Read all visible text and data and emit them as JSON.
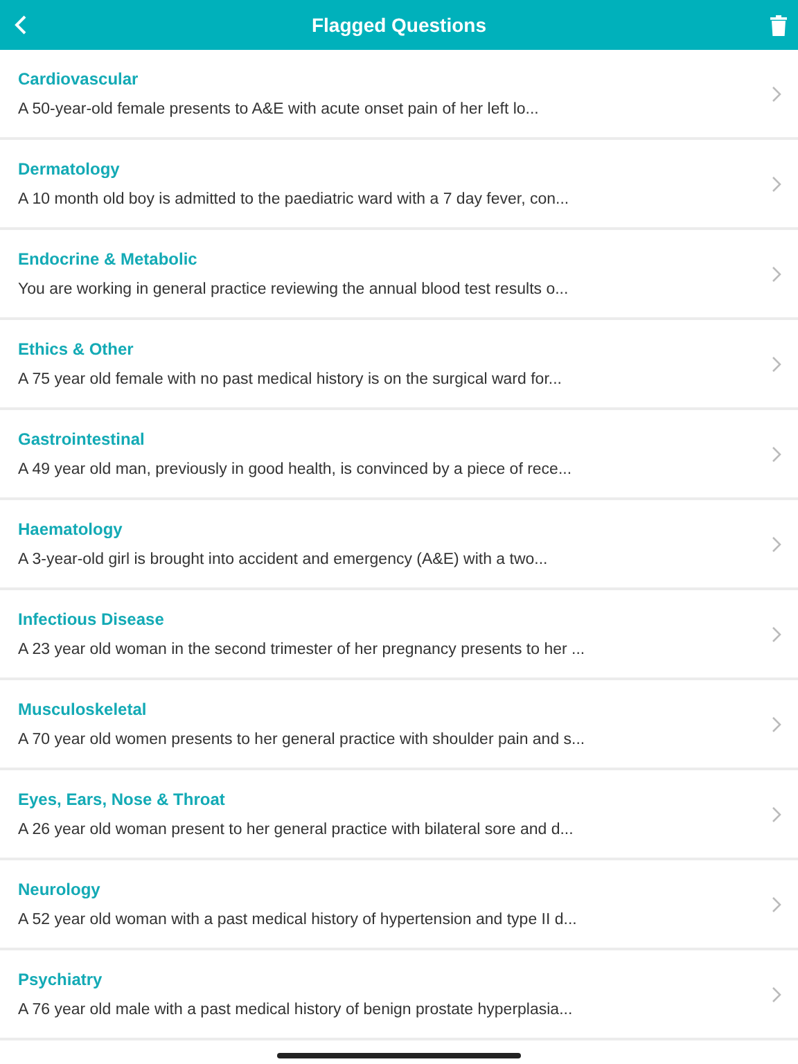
{
  "header": {
    "title": "Flagged Questions"
  },
  "questions": [
    {
      "category": "Cardiovascular",
      "snippet": "A 50-year-old female presents to A&E with acute onset pain of her left lo..."
    },
    {
      "category": "Dermatology",
      "snippet": "A 10 month old boy is admitted to the paediatric ward with a 7 day fever, con..."
    },
    {
      "category": "Endocrine & Metabolic",
      "snippet": "You are working in general practice reviewing the annual blood test results o..."
    },
    {
      "category": "Ethics & Other",
      "snippet": "A 75 year old female with no past medical history is on the surgical ward for..."
    },
    {
      "category": "Gastrointestinal",
      "snippet": "A 49 year old man, previously in good health, is convinced by a piece of rece..."
    },
    {
      "category": "Haematology",
      "snippet": "A 3-year-old girl is brought into accident and emergency (A&E) with a two..."
    },
    {
      "category": "Infectious Disease",
      "snippet": "A 23 year old woman in the second trimester of her pregnancy presents to her ..."
    },
    {
      "category": "Musculoskeletal",
      "snippet": "A 70 year old women presents to her general practice with shoulder pain and s..."
    },
    {
      "category": "Eyes, Ears, Nose & Throat",
      "snippet": "A 26 year old woman present to her general practice with bilateral sore and d..."
    },
    {
      "category": "Neurology",
      "snippet": "A 52 year old woman with a past medical history of hypertension and type II d..."
    },
    {
      "category": "Psychiatry",
      "snippet": "A 76 year old male with a past medical history of benign prostate hyperplasia..."
    }
  ]
}
